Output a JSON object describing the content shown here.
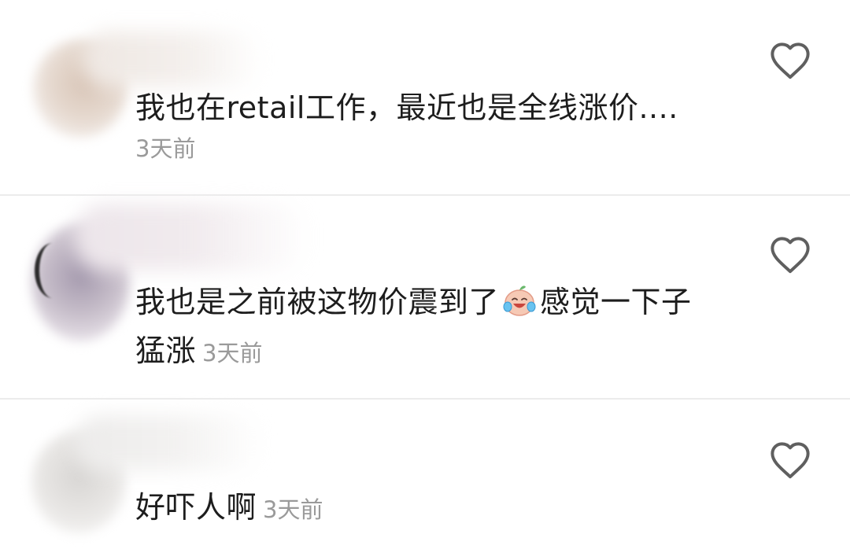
{
  "comments": [
    {
      "text": "我也在retail工作，最近也是全线涨价....",
      "time": "3天前"
    },
    {
      "text_before_emoji": "我也是之前被这物价震到了",
      "emoji": "crying-laughing-emoji",
      "text_after_emoji": "感觉一下子猛涨",
      "time": "3天前"
    },
    {
      "text": "好吓人啊",
      "time": "3天前"
    }
  ],
  "icons": {
    "like": "heart-outline-icon"
  },
  "colors": {
    "text": "#1d1d1d",
    "timestamp": "#9a9a9a",
    "divider": "#ececec",
    "icon_stroke": "#5f5f5f"
  }
}
